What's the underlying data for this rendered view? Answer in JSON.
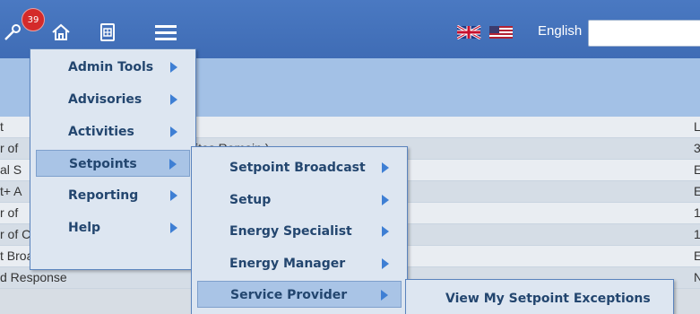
{
  "topbar": {
    "notification_count": "39",
    "language": "English",
    "search_value": ""
  },
  "icons": {
    "tools": "wrench-icon",
    "home": "home-icon",
    "report": "document-icon",
    "menu": "hamburger-menu-icon",
    "flag_uk": "uk-flag-icon",
    "flag_us": "us-flag-icon"
  },
  "rows": [
    {
      "c1": "t ",
      "c2": "",
      "c3": "L"
    },
    {
      "c1": "r of",
      "c2": "ites Remain )",
      "c3": "3"
    },
    {
      "c1": "al S",
      "c2": "",
      "c3": "E"
    },
    {
      "c1": "t+ A",
      "c2": "",
      "c3": "E"
    },
    {
      "c1": "r of",
      "c2": "",
      "c3": "1"
    },
    {
      "c1": "r of Connections for ISDN",
      "c2": "",
      "c3": "1"
    },
    {
      "c1": "t Broadcast",
      "c2": "",
      "c3": "E"
    },
    {
      "c1": "d Response",
      "c2": "",
      "c3": "N"
    }
  ],
  "menu_main": [
    {
      "label": "Admin Tools"
    },
    {
      "label": "Advisories"
    },
    {
      "label": "Activities"
    },
    {
      "label": "Setpoints"
    },
    {
      "label": "Reporting"
    },
    {
      "label": "Help"
    }
  ],
  "menu_setpoints": [
    {
      "label": "Setpoint Broadcast"
    },
    {
      "label": "Setup"
    },
    {
      "label": "Energy Specialist"
    },
    {
      "label": "Energy Manager"
    },
    {
      "label": "Service Provider"
    }
  ],
  "menu_service_provider": [
    {
      "label": "View My Setpoint Exceptions"
    }
  ],
  "colors": {
    "topbar": "#4a79c2",
    "subbar": "#a3c1e6",
    "menu_bg": "#dde6f1",
    "menu_text": "#23466f",
    "arrow": "#3e7fd4",
    "badge": "#d42a2a"
  }
}
